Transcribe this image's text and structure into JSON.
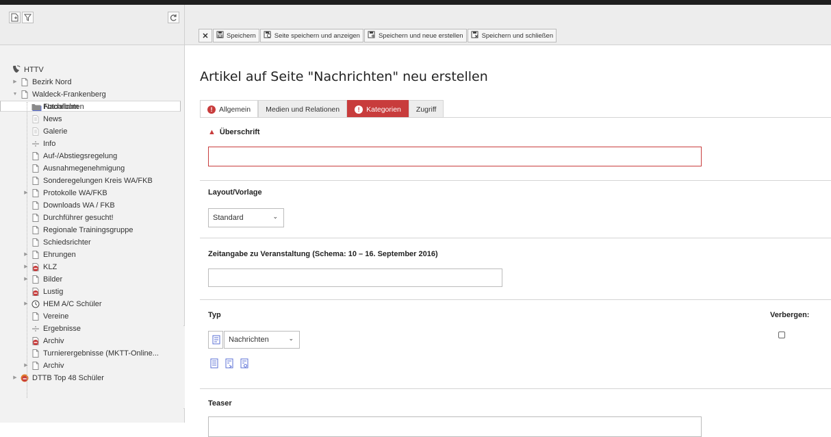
{
  "sidebar": {
    "tools": {
      "new_page": "new-page-icon",
      "filter": "filter-icon",
      "refresh": "refresh-icon"
    },
    "root": "HTTV",
    "tree": [
      {
        "label": "Bezirk Nord",
        "icon": "page",
        "depth": 1,
        "toggle": "collapsed"
      },
      {
        "label": "Waldeck-Frankenberg",
        "icon": "page",
        "depth": 1,
        "toggle": "expanded"
      },
      {
        "label": "Nachrichten",
        "icon": "folder-blue",
        "depth": 2,
        "selected": true
      },
      {
        "label": "Fotoalbum",
        "icon": "folder-grey",
        "depth": 2
      },
      {
        "label": "News",
        "icon": "page-faded",
        "depth": 2
      },
      {
        "label": "Galerie",
        "icon": "page-faded",
        "depth": 2
      },
      {
        "label": "Info",
        "icon": "divider",
        "depth": 2
      },
      {
        "label": "Auf-/Abstiegsregelung",
        "icon": "page",
        "depth": 2
      },
      {
        "label": "Ausnahmegenehmigung",
        "icon": "page",
        "depth": 2
      },
      {
        "label": "Sonderegelungen Kreis WA/FKB",
        "icon": "page",
        "depth": 2
      },
      {
        "label": "Protokolle WA/FKB",
        "icon": "page",
        "depth": 2,
        "toggle": "collapsed"
      },
      {
        "label": "Downloads WA / FKB",
        "icon": "page",
        "depth": 2
      },
      {
        "label": "Durchführer gesucht!",
        "icon": "page",
        "depth": 2
      },
      {
        "label": "Regionale Trainingsgruppe",
        "icon": "page",
        "depth": 2
      },
      {
        "label": "Schiedsrichter",
        "icon": "page",
        "depth": 2
      },
      {
        "label": "Ehrungen",
        "icon": "page",
        "depth": 2,
        "toggle": "collapsed"
      },
      {
        "label": "KLZ",
        "icon": "page-restricted",
        "depth": 2,
        "toggle": "collapsed"
      },
      {
        "label": "Bilder",
        "icon": "page",
        "depth": 2,
        "toggle": "collapsed"
      },
      {
        "label": "Lustig",
        "icon": "page-restricted",
        "depth": 2
      },
      {
        "label": "HEM A/C Schüler",
        "icon": "page-timed",
        "depth": 2,
        "toggle": "collapsed"
      },
      {
        "label": "Vereine",
        "icon": "page",
        "depth": 2
      },
      {
        "label": "Ergebnisse",
        "icon": "divider",
        "depth": 2
      },
      {
        "label": "Archiv",
        "icon": "page-restricted",
        "depth": 2
      },
      {
        "label": "Turnierergebnisse (MKTT-Online...",
        "icon": "page",
        "depth": 2
      },
      {
        "label": "Archiv",
        "icon": "page",
        "depth": 2,
        "toggle": "collapsed"
      },
      {
        "label": "DTTB Top 48 Schüler",
        "icon": "shortcut-restricted",
        "depth": 1,
        "toggle": "collapsed"
      }
    ]
  },
  "toolbar": {
    "close_icon": "close-icon",
    "save": "Speichern",
    "save_view": "Seite speichern und anzeigen",
    "save_new": "Speichern und neue erstellen",
    "save_close": "Speichern und schließen"
  },
  "page": {
    "title": "Artikel auf Seite \"Nachrichten\" neu erstellen"
  },
  "tabs": [
    {
      "label": "Allgemein",
      "active": true,
      "error": true
    },
    {
      "label": "Medien und Relationen"
    },
    {
      "label": "Kategorien",
      "error": true
    },
    {
      "label": "Zugriff"
    }
  ],
  "form": {
    "headline": {
      "label": "Überschrift",
      "value": ""
    },
    "layout": {
      "label": "Layout/Vorlage",
      "value": "Standard"
    },
    "event_date": {
      "label": "Zeitangabe zu Veranstaltung (Schema: 10 – 16. September 2016)",
      "value": ""
    },
    "type": {
      "label": "Typ",
      "value": "Nachrichten"
    },
    "hidden": {
      "label": "Verbergen:",
      "checked": false
    },
    "teaser": {
      "label": "Teaser"
    }
  },
  "colors": {
    "error": "#c83c3c",
    "folder_blue": "#5a6fd6",
    "topbar": "#1f1f1f"
  }
}
